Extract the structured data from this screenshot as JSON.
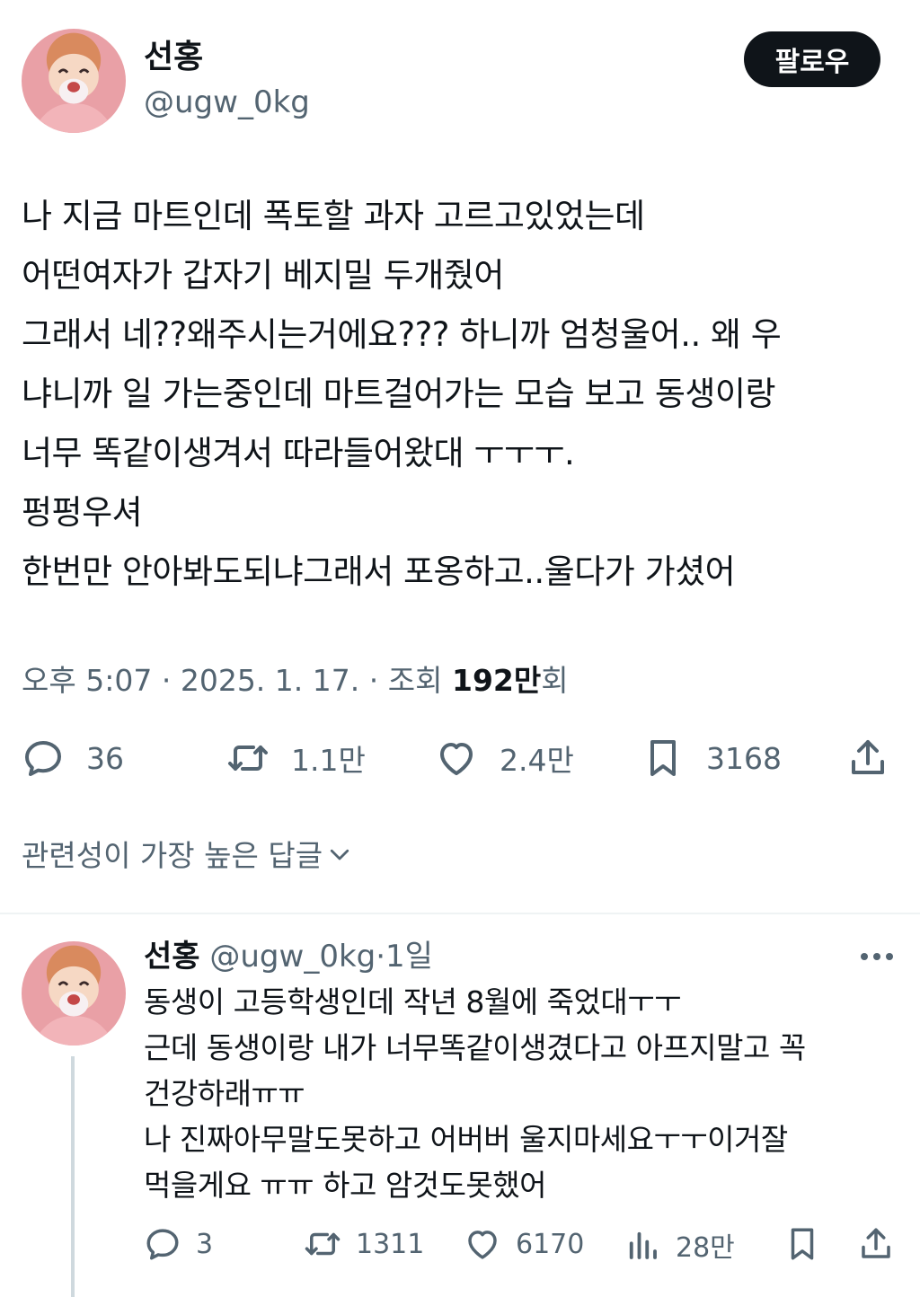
{
  "author": {
    "name": "선홍",
    "handle": "@ugw_0kg"
  },
  "follow_label": "팔로우",
  "tweet": {
    "lines": [
      "나 지금 마트인데 폭토할 과자 고르고있었는데",
      "어떤여자가 갑자기 베지밀 두개줬어",
      "그래서 네??왜주시는거에요??? 하니까 엄청울어.. 왜 우",
      "냐니까 일 가는중인데 마트걸어가는 모습 보고 동생이랑",
      "너무 똑같이생겨서 따라들어왔대 ㅜㅜㅜ.",
      "펑펑우셔",
      "한번만 안아봐도되냐그래서 포옹하고..울다가 가셨어"
    ],
    "time": "오후 5:07",
    "date": "2025. 1. 17.",
    "views_prefix": "조회",
    "views_count": "192만",
    "views_suffix": "회",
    "sep": "·"
  },
  "actions": {
    "replies": "36",
    "reposts": "1.1만",
    "likes": "2.4만",
    "bookmarks": "3168"
  },
  "sort_label": "관련성이 가장 높은 답글",
  "reply": {
    "name": "선홍",
    "handle": "@ugw_0kg",
    "sep": "·",
    "time": "1일",
    "lines": [
      "동생이 고등학생인데 작년 8월에 죽었대ㅜㅜ",
      "근데 동생이랑 내가 너무똑같이생겼다고 아프지말고 꼭",
      "건강하래ㅠㅠ",
      "나 진짜아무말도못하고 어버버 울지마세요ㅜㅜ이거잘",
      "먹을게요 ㅠㅠ 하고 암것도못했어"
    ],
    "actions": {
      "replies": "3",
      "reposts": "1311",
      "likes": "6170",
      "views": "28만"
    }
  },
  "colors": {
    "text": "#0f1419",
    "secondary": "#536471",
    "divider": "#eff3f4",
    "button_bg": "#0f1419",
    "avatar_bg": "#e9a0a6"
  }
}
